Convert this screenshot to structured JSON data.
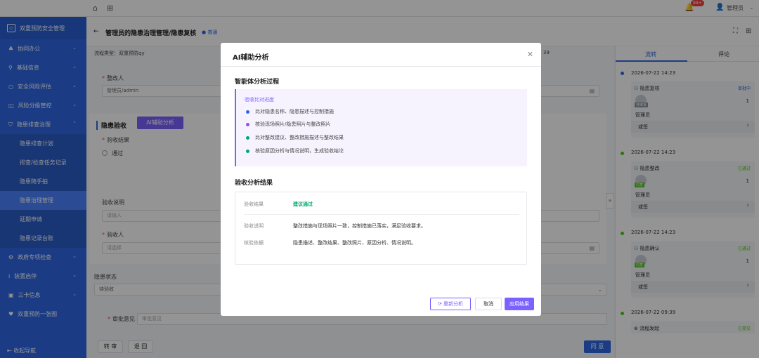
{
  "topbar": {
    "home_icon": "⌂",
    "apps_icon": "⊞",
    "bell_badge": "99+",
    "user": "管理员"
  },
  "sidebar": {
    "brand": "双重预防安全管理",
    "items": [
      {
        "label": "协同办公"
      },
      {
        "label": "基础信息"
      },
      {
        "label": "安全风险评估"
      },
      {
        "label": "风险分级管控"
      },
      {
        "label": "隐患排查治理"
      }
    ],
    "sub_items": [
      {
        "label": "隐患排查计划"
      },
      {
        "label": "排查/检查任务记录"
      },
      {
        "label": "隐患随手拍"
      },
      {
        "label": "隐患治理管理"
      },
      {
        "label": "延期申请"
      },
      {
        "label": "隐患记录台账"
      }
    ],
    "items_after": [
      {
        "label": "政府专项检查"
      },
      {
        "label": "装置启停"
      },
      {
        "label": "三卡信息"
      },
      {
        "label": "双重预防一张图"
      }
    ],
    "collapse": "收起导航"
  },
  "header": {
    "title": "管理员的隐患治理管理/隐患复核",
    "tag": "普通"
  },
  "form": {
    "flow_type": "流程类型：双重预防qy",
    "right_info": "39",
    "rectifier_label": "整改人",
    "rectifier_value": "管理员/admin",
    "acceptance_title": "隐患验收",
    "ai_button": "AI辅助分析",
    "result_label": "验收结果",
    "option_pass": "通过",
    "desc_label": "验收说明",
    "desc_placeholder": "请输入",
    "acceptor_label": "验收人",
    "acceptor_placeholder": "请选择",
    "status_label": "隐患状态",
    "status_value": "待验收",
    "approve_label": "审批意见",
    "approve_placeholder": "审批意见",
    "btn_transfer": "转 审",
    "btn_return": "退 回",
    "btn_agree": "同 意"
  },
  "right": {
    "tab_flow": "流转",
    "tab_comment": "评论",
    "timeline": [
      {
        "time": "2026-07-22 14:23",
        "node": "隐患复核",
        "status": "审批中",
        "tag": "待审批",
        "count": "1",
        "person": "管理员",
        "sign": "或签"
      },
      {
        "time": "2026-07-22 14:23",
        "node": "隐患整改",
        "status": "已通过",
        "tag": "同意",
        "count": "1",
        "person": "管理员",
        "sign": "或签"
      },
      {
        "time": "2026-07-22 14:23",
        "node": "隐患确认",
        "status": "已通过",
        "tag": "同意",
        "count": "1",
        "person": "管理员",
        "sign": "或签"
      },
      {
        "time": "2026-07-22 09:39",
        "node": "流程发起",
        "status": "已提交"
      }
    ]
  },
  "dialog": {
    "title": "AI辅助分析",
    "process_title": "智能体分析过程",
    "progress_header": "验收比对进度",
    "steps": [
      {
        "text": "比对隐患名称、隐患描述与控制措施",
        "color": "#2f68e3"
      },
      {
        "text": "核验现场照片/隐患照片与整改照片",
        "color": "#9254de"
      },
      {
        "text": "比对整改建议、整改措施描述与整改结果",
        "color": "#00a870"
      },
      {
        "text": "核验原因分析与情况说明，生成验收结论",
        "color": "#00a870"
      }
    ],
    "result_title": "验收分析结果",
    "result_rows": [
      {
        "key": "验收结果",
        "value": "建议通过"
      },
      {
        "key": "验收说明",
        "value": "整改措施与现场照片一致，控制措施已落实，满足验收要求。"
      },
      {
        "key": "核验依据",
        "value": "隐患描述、整改结果、整改照片、原因分析、情况说明。"
      }
    ],
    "btn_reanalyze": "重新分析",
    "btn_cancel": "取消",
    "btn_apply": "应用结果"
  }
}
